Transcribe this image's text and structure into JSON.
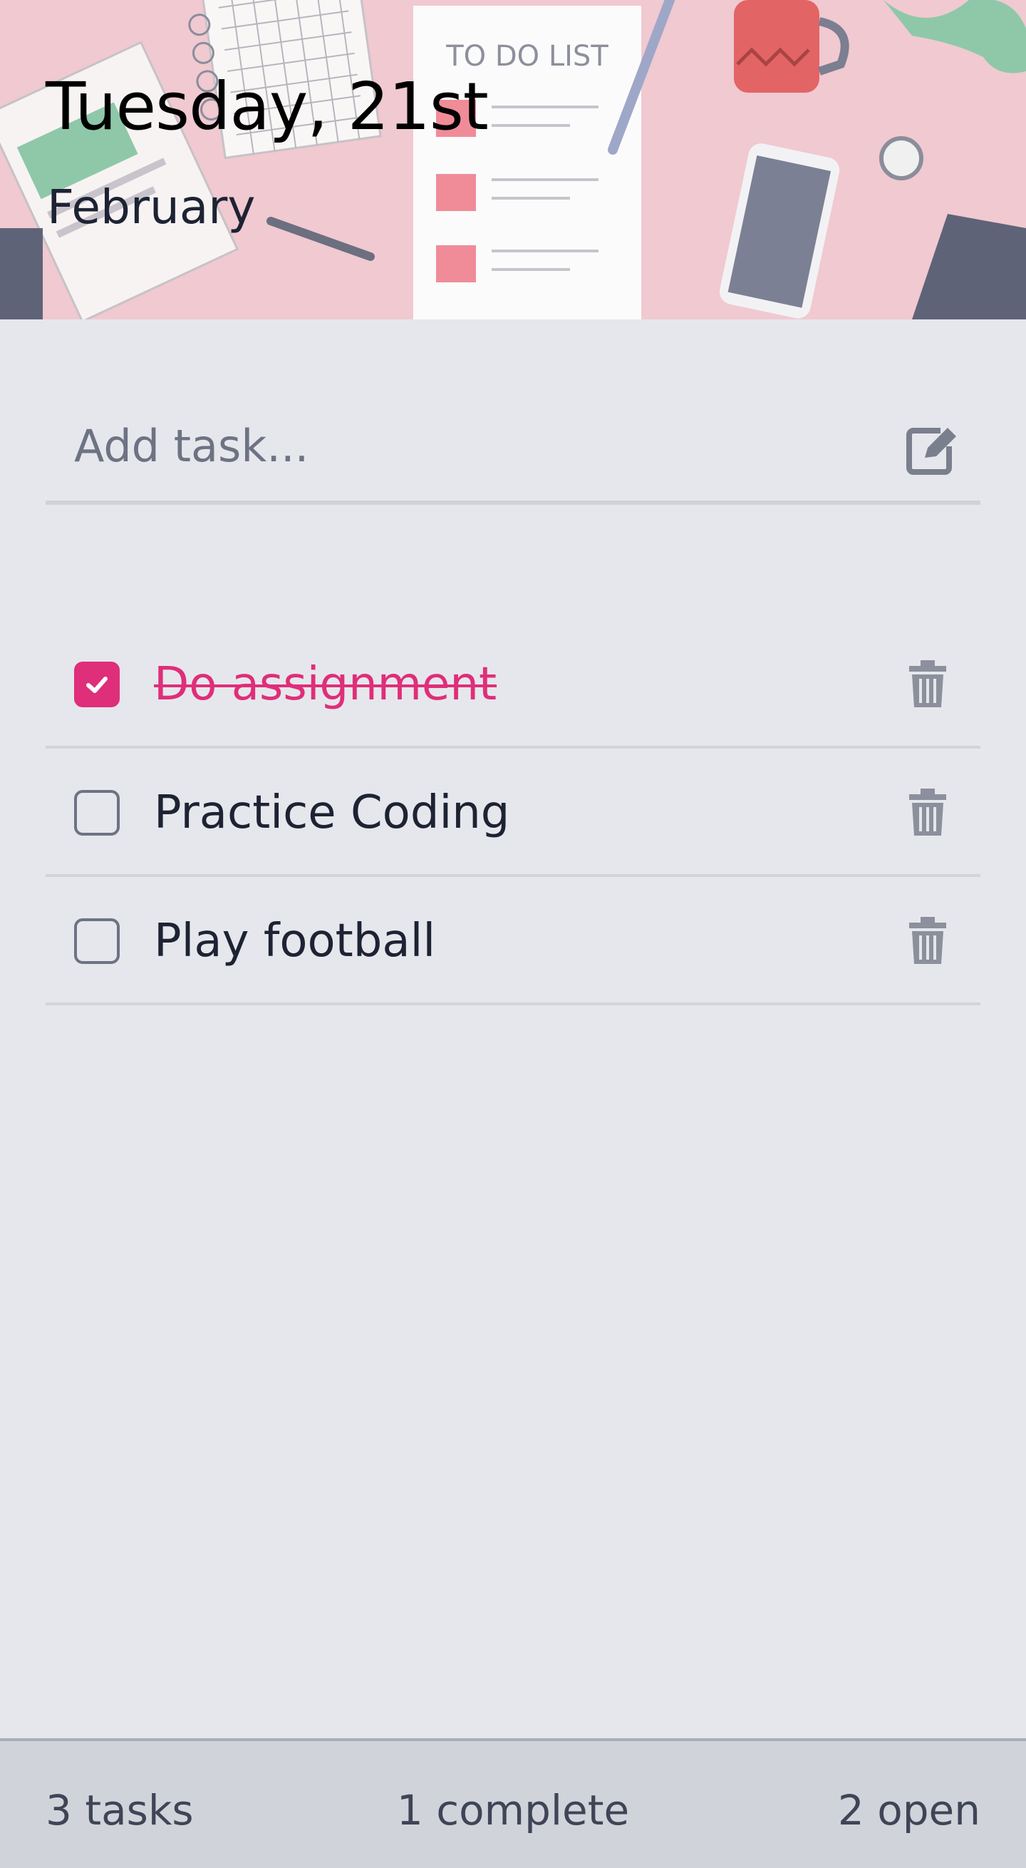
{
  "header": {
    "date_title": "Tuesday, 21st",
    "month": "February",
    "illustration": {
      "notepad_title": "TO DO LIST"
    }
  },
  "add_task": {
    "placeholder": "Add task...",
    "value": "",
    "icon": "edit-icon"
  },
  "tasks": [
    {
      "label": "Do assignment",
      "completed": true
    },
    {
      "label": "Practice Coding",
      "completed": false
    },
    {
      "label": "Play football",
      "completed": false
    }
  ],
  "footer": {
    "total": "3 tasks",
    "complete": "1 complete",
    "open": "2 open"
  },
  "colors": {
    "accent": "#df2e7a",
    "background": "#e6e7ec",
    "header_bg": "#f0c9d1",
    "footer_bg": "#d1d3db"
  }
}
